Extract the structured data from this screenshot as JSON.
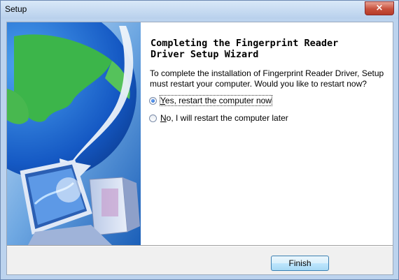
{
  "window": {
    "title": "Setup",
    "close_label": "×"
  },
  "wizard": {
    "heading": "Completing the Fingerprint Reader\nDriver Setup Wizard",
    "body": "To complete the installation of Fingerprint Reader Driver, Setup must restart your computer. Would you like to restart now?",
    "options": [
      {
        "label": "Yes, restart the computer now",
        "mnemonic": "Y",
        "rest": "es, restart the computer now",
        "selected": true
      },
      {
        "label": "No, I will restart the computer later",
        "mnemonic": "N",
        "rest": "o, I will restart the computer later",
        "selected": false
      }
    ],
    "finish_label": "Finish"
  }
}
